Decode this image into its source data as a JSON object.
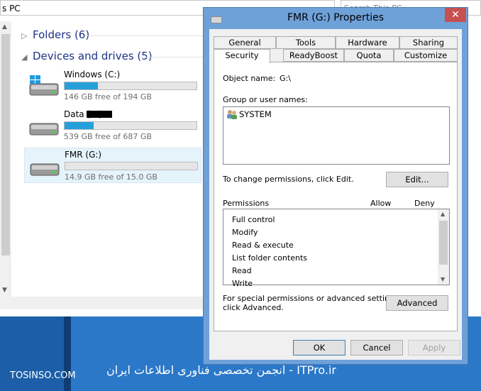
{
  "explorer": {
    "address": "s PC",
    "search_placeholder": "Search This PC",
    "folders_group": "Folders (6)",
    "devices_group": "Devices and drives (5)",
    "drives": [
      {
        "name": "Windows (C:)",
        "free": "146 GB free of 194 GB",
        "used_fraction": 0.25
      },
      {
        "name": "Data (E:)",
        "free": "539 GB free of 687 GB",
        "used_fraction": 0.22
      },
      {
        "name": "FMR (G:)",
        "free": "14.9 GB free of 15.0 GB",
        "used_fraction": 0.0
      }
    ]
  },
  "dialog": {
    "title": "FMR (G:) Properties",
    "close_glyph": "✕",
    "tabs_row1": [
      "General",
      "Tools",
      "Hardware",
      "Sharing"
    ],
    "tabs_row2": [
      "Security",
      "ReadyBoost",
      "Quota",
      "Customize"
    ],
    "active_tab": "Security",
    "object_name_label": "Object name:",
    "object_name_value": "G:\\",
    "group_label": "Group or user names:",
    "groups": [
      "SYSTEM"
    ],
    "change_perm_text": "To change permissions, click Edit.",
    "edit_button": "Edit...",
    "permissions_label": "Permissions",
    "allow_label": "Allow",
    "deny_label": "Deny",
    "permissions": [
      "Full control",
      "Modify",
      "Read & execute",
      "List folder contents",
      "Read",
      "Write"
    ],
    "special_text_1": "For special permissions or advanced settings,",
    "special_text_2": "click Advanced.",
    "advanced_button": "Advanced",
    "ok_button": "OK",
    "cancel_button": "Cancel",
    "apply_button": "Apply"
  },
  "watermark": {
    "left": "TOSINSO.COM",
    "right": "ITPro.ir - انجمن تخصصی فناوری اطلاعات ایران"
  },
  "colors": {
    "accent": "#26a0da",
    "dialog_frame": "#6ea1d8",
    "close": "#c75050",
    "taskbar": "#1c5fa8"
  }
}
